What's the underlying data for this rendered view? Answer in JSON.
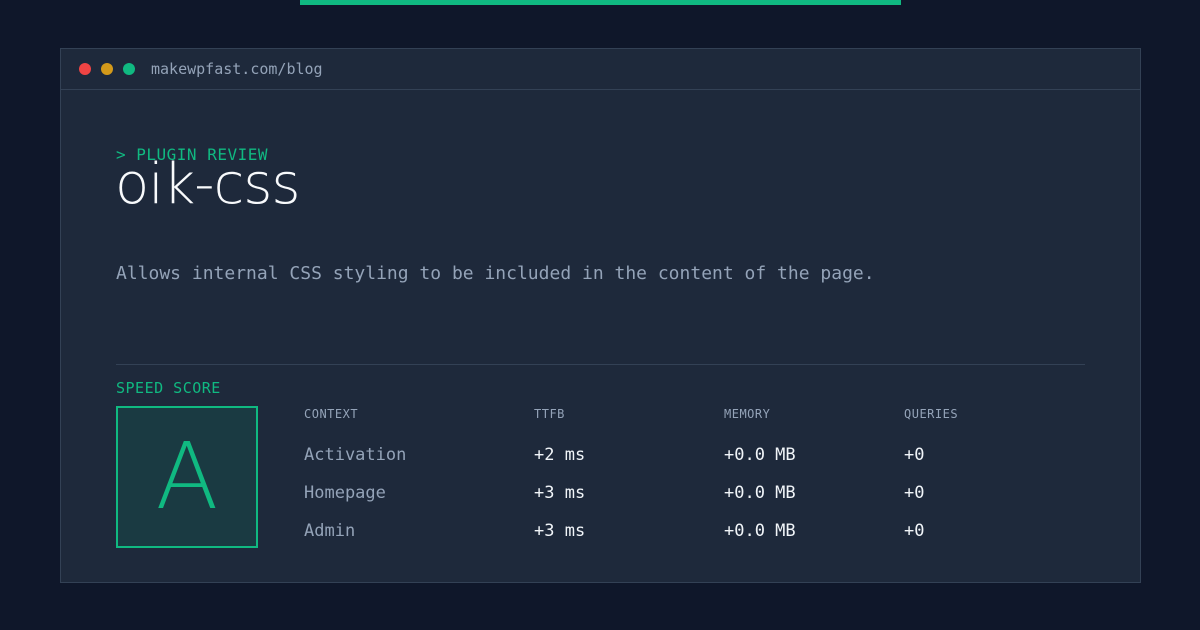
{
  "window": {
    "url": "makewpfast.com/blog"
  },
  "header": {
    "eyebrow": "> PLUGIN REVIEW",
    "title": "oik-css",
    "description": "Allows internal CSS styling to be included in the content of the page."
  },
  "score": {
    "label": "SPEED SCORE",
    "grade": "A"
  },
  "table": {
    "headers": [
      "CONTEXT",
      "TTFB",
      "MEMORY",
      "QUERIES"
    ],
    "rows": [
      [
        "Activation",
        "+2 ms",
        "+0.0 MB",
        "+0"
      ],
      [
        "Homepage",
        "+3 ms",
        "+0.0 MB",
        "+0"
      ],
      [
        "Admin",
        "+3 ms",
        "+0.0 MB",
        "+0"
      ]
    ]
  },
  "colors": {
    "background": "#0f172a",
    "panel": "#1e293b",
    "accent": "#10b981",
    "muted": "#94a3b8",
    "text": "#f8fafc"
  }
}
